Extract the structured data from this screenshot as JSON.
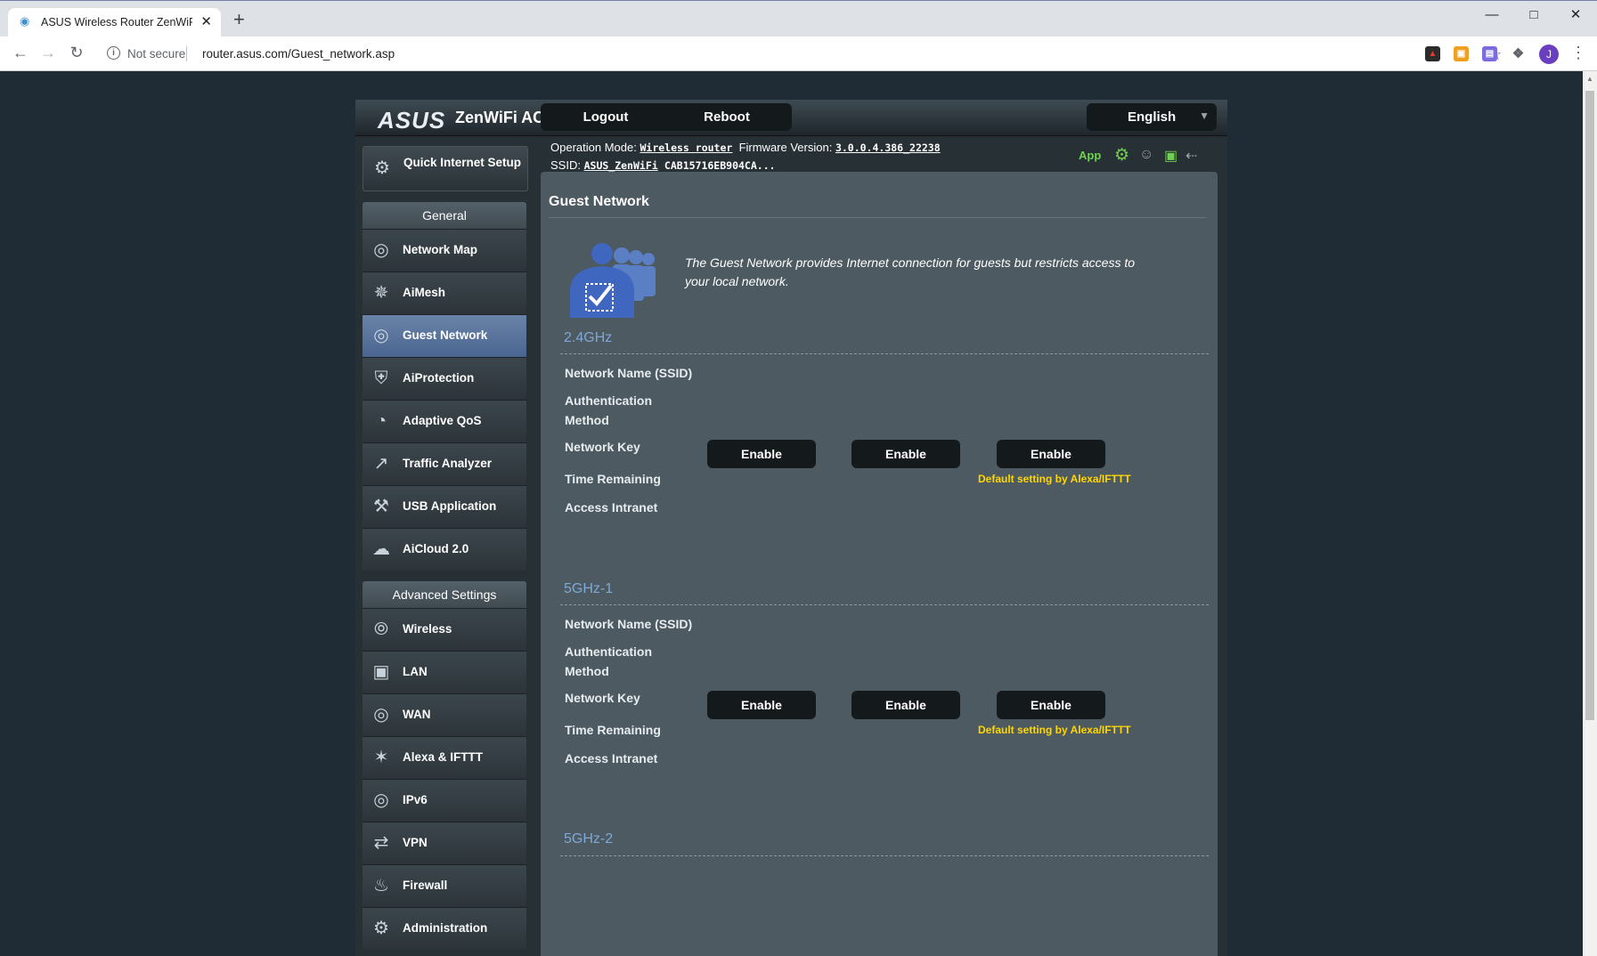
{
  "browser": {
    "tab_title": "ASUS Wireless Router ZenWiFi AC",
    "new_tab": "+",
    "security": "Not secure",
    "url": "router.asus.com/Guest_network.asp",
    "avatar_letter": "J",
    "window_controls": [
      "minimize",
      "maximize",
      "close"
    ]
  },
  "header": {
    "logo": "ASUS",
    "model": "ZenWiFi AC",
    "logout": "Logout",
    "reboot": "Reboot",
    "language": "English"
  },
  "status": {
    "op_mode_label": "Operation Mode:",
    "op_mode_value": "Wireless router",
    "fw_label": "Firmware Version:",
    "fw_value": "3.0.0.4.386_22238",
    "ssid_label": "SSID:",
    "ssid_value": "ASUS_ZenWiFi",
    "ssid_2": "CAB15716EB904CA...",
    "app": "App"
  },
  "sidebar": {
    "quick_setup": "Quick Internet Setup",
    "general_header": "General",
    "general": [
      {
        "label": "Network Map",
        "icon": "globe-icon"
      },
      {
        "label": "AiMesh",
        "icon": "mesh-icon"
      },
      {
        "label": "Guest Network",
        "icon": "guest-network-icon",
        "active": true
      },
      {
        "label": "AiProtection",
        "icon": "lock-icon"
      },
      {
        "label": "Adaptive QoS",
        "icon": "gauge-icon"
      },
      {
        "label": "Traffic Analyzer",
        "icon": "traffic-icon"
      },
      {
        "label": "USB Application",
        "icon": "usb-icon"
      },
      {
        "label": "AiCloud 2.0",
        "icon": "cloud-icon"
      }
    ],
    "advanced_header": "Advanced Settings",
    "advanced": [
      {
        "label": "Wireless",
        "icon": "wireless-icon"
      },
      {
        "label": "LAN",
        "icon": "lan-icon"
      },
      {
        "label": "WAN",
        "icon": "wan-icon"
      },
      {
        "label": "Alexa & IFTTT",
        "icon": "alexa-icon"
      },
      {
        "label": "IPv6",
        "icon": "ipv6-icon"
      },
      {
        "label": "VPN",
        "icon": "vpn-icon"
      },
      {
        "label": "Firewall",
        "icon": "firewall-icon"
      },
      {
        "label": "Administration",
        "icon": "admin-icon"
      }
    ]
  },
  "main": {
    "title": "Guest Network",
    "description": "The Guest Network provides Internet connection for guests but restricts access to your local network.",
    "row_labels": {
      "ssid": "Network Name (SSID)",
      "auth": "Authentication",
      "method": "Method",
      "key": "Network Key",
      "time": "Time Remaining",
      "intranet": "Access Intranet"
    },
    "enable": "Enable",
    "alexa_note": "Default setting by Alexa/IFTTT",
    "bands": [
      "2.4GHz",
      "5GHz-1",
      "5GHz-2"
    ]
  }
}
